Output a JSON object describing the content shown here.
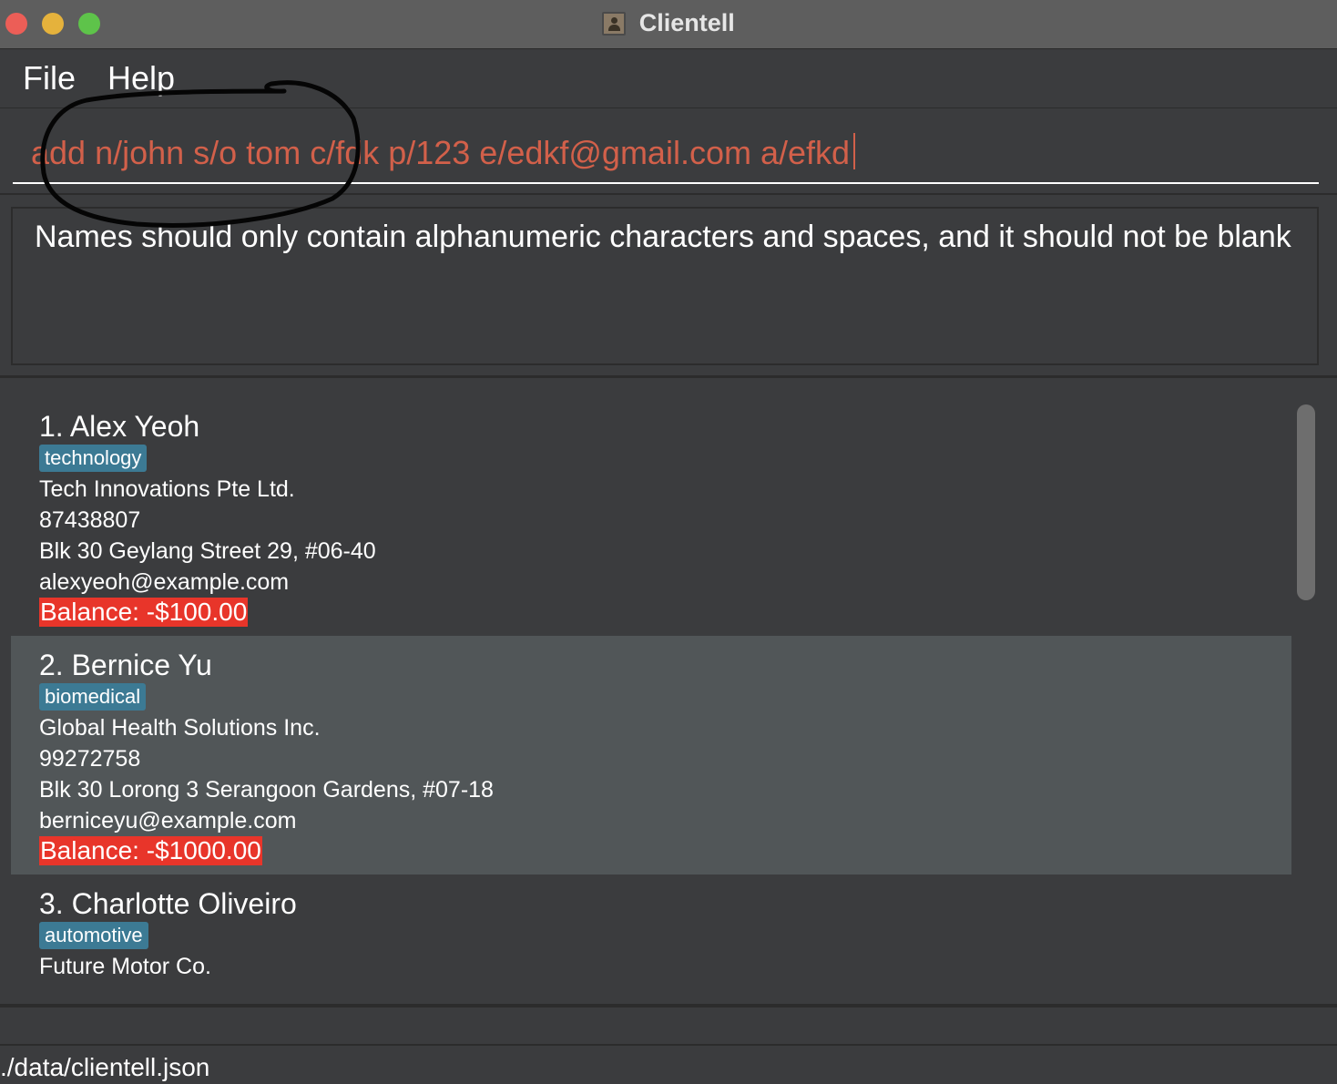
{
  "window": {
    "title": "Clientell",
    "app_icon": "contacts-book-icon"
  },
  "menu": {
    "items": [
      {
        "label": "File"
      },
      {
        "label": "Help"
      }
    ]
  },
  "command_box": {
    "value": "add n/john s/o tom c/fdk p/123 e/edkf@gmail.com a/efkd",
    "text_color": "#d2604a"
  },
  "result_display": {
    "message": "Names should only contain alphanumeric characters and spaces, and it should not be blank"
  },
  "persons": [
    {
      "name": "1. Alex Yeoh",
      "tag": "technology",
      "company": "Tech Innovations Pte Ltd.",
      "phone": "87438807",
      "address": "Blk 30 Geylang Street 29, #06-40",
      "email": "alexyeoh@example.com",
      "balance": "Balance: -$100.00"
    },
    {
      "name": "2. Bernice Yu",
      "tag": "biomedical",
      "company": "Global Health Solutions Inc.",
      "phone": "99272758",
      "address": "Blk 30 Lorong 3 Serangoon Gardens, #07-18",
      "email": "berniceyu@example.com",
      "balance": "Balance: -$1000.00"
    },
    {
      "name": "3. Charlotte Oliveiro",
      "tag": "automotive",
      "company": "Future Motor Co."
    }
  ],
  "status_bar": {
    "file_path": "./data/clientell.json"
  },
  "colors": {
    "background": "#3b3c3e",
    "selected_row": "#515658",
    "tag": "#3c7a94",
    "negative_balance": "#e8352a"
  }
}
